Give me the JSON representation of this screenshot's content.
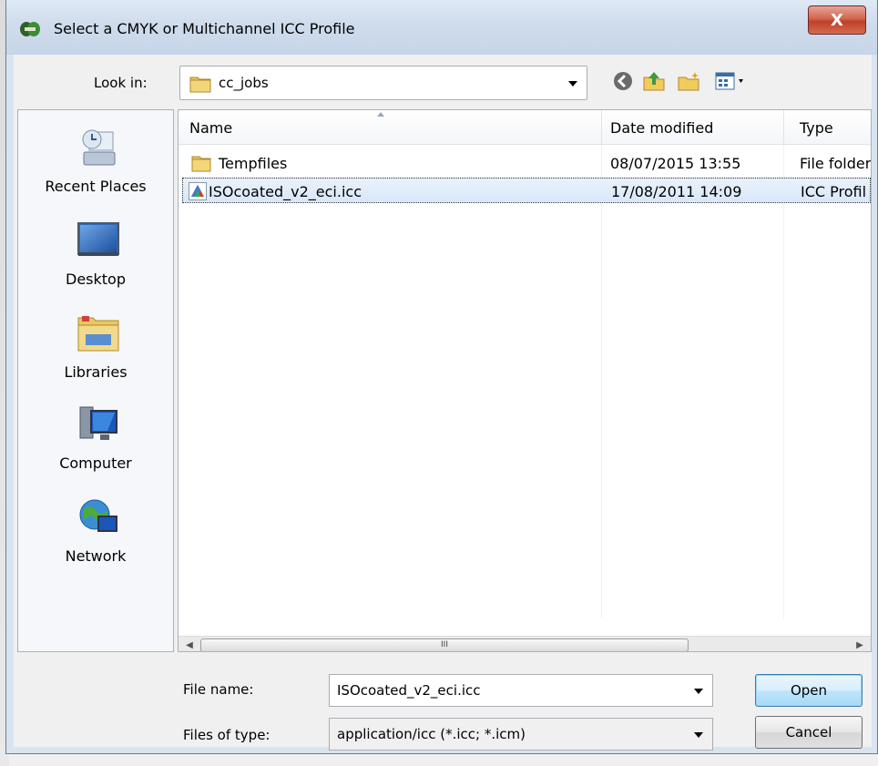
{
  "window": {
    "title": "Select a CMYK or Multichannel ICC Profile",
    "close_label": "X"
  },
  "lookin": {
    "label": "Look in:",
    "value": "cc_jobs"
  },
  "toolbar": {
    "icons": [
      "back-icon",
      "up-folder-icon",
      "new-folder-icon",
      "view-menu-icon"
    ]
  },
  "places": [
    {
      "label": "Recent Places",
      "icon": "recent-places-icon"
    },
    {
      "label": "Desktop",
      "icon": "desktop-icon"
    },
    {
      "label": "Libraries",
      "icon": "libraries-icon"
    },
    {
      "label": "Computer",
      "icon": "computer-icon"
    },
    {
      "label": "Network",
      "icon": "network-icon"
    }
  ],
  "columns": {
    "name": "Name",
    "date": "Date modified",
    "type": "Type"
  },
  "files": [
    {
      "name": "Tempfiles",
      "date": "08/07/2015 13:55",
      "type": "File folder",
      "icon": "folder-icon"
    },
    {
      "name": "ISOcoated_v2_eci.icc",
      "date": "17/08/2011 14:09",
      "type": "ICC Profil",
      "icon": "icc-profile-icon"
    }
  ],
  "scrollbar": {
    "thumb_label": "III"
  },
  "filename": {
    "label": "File name:",
    "value": "ISOcoated_v2_eci.icc"
  },
  "filetype": {
    "label": "Files of type:",
    "value": "application/icc (*.icc; *.icm)"
  },
  "buttons": {
    "open": "Open",
    "cancel": "Cancel"
  }
}
